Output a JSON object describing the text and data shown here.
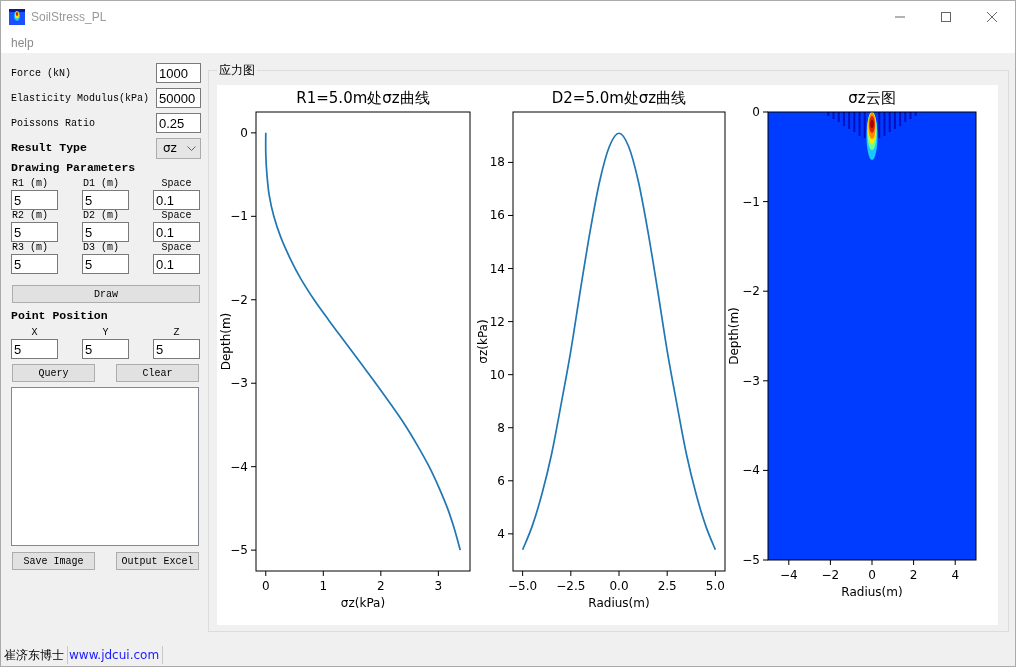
{
  "window": {
    "title": "SoilStress_PL"
  },
  "menu": [
    {
      "label": "help"
    }
  ],
  "inputs": [
    {
      "label": "Force (kN)",
      "value": "1000"
    },
    {
      "label": "Elasticity Modulus(kPa)",
      "value": "50000"
    },
    {
      "label": "Poissons Ratio",
      "value": "0.25"
    }
  ],
  "result_type": {
    "label": "Result Type",
    "value": "σz"
  },
  "drawing_parameters": {
    "title": "Drawing Parameters",
    "rows": [
      [
        {
          "label": "R1 (m)",
          "value": "5"
        },
        {
          "label": "D1 (m)",
          "value": "5"
        },
        {
          "label": "Space",
          "value": "0.1"
        }
      ],
      [
        {
          "label": "R2 (m)",
          "value": "5"
        },
        {
          "label": "D2 (m)",
          "value": "5"
        },
        {
          "label": "Space",
          "value": "0.1"
        }
      ],
      [
        {
          "label": "R3 (m)",
          "value": "5"
        },
        {
          "label": "D3 (m)",
          "value": "5"
        },
        {
          "label": "Space",
          "value": "0.1"
        }
      ]
    ]
  },
  "draw_button": {
    "label": "Draw"
  },
  "point_position": {
    "title": "Point Position",
    "fields": [
      {
        "label": "X",
        "value": "5"
      },
      {
        "label": "Y",
        "value": "5"
      },
      {
        "label": "Z",
        "value": "5"
      }
    ]
  },
  "query_buttons": [
    {
      "label": "Query"
    },
    {
      "label": "Clear"
    }
  ],
  "export_buttons": [
    {
      "label": "Save Image"
    },
    {
      "label": "Output Excel"
    }
  ],
  "stress_panel": {
    "title": "应力图",
    "plots": [
      {
        "kind": "line",
        "chart_data": {
          "type": "line",
          "title": "R1=5.0m处σz曲线",
          "xlabel": "σz(kPa)",
          "ylabel": "Depth(m)",
          "x": [
            0,
            0,
            0.02,
            0.06,
            0.14,
            0.26,
            0.42,
            0.61,
            0.84,
            1.1,
            1.37,
            1.64,
            1.91,
            2.17,
            2.42,
            2.64,
            2.84,
            3.01,
            3.16,
            3.28,
            3.38
          ],
          "series": [
            {
              "color": "#1f77b4",
              "values": [
                0,
                -0.25,
                -0.5,
                -0.75,
                -1,
                -1.25,
                -1.5,
                -1.75,
                -2,
                -2.25,
                -2.5,
                -2.75,
                -3,
                -3.25,
                -3.5,
                -3.75,
                -4,
                -4.25,
                -4.5,
                -4.75,
                -5
              ]
            }
          ],
          "xlim": [
            -0.17,
            3.55
          ],
          "ylim": [
            -5.25,
            0.25
          ],
          "xticks": [
            0,
            1,
            2,
            3
          ],
          "yticks": [
            0,
            {
              "value": -1,
              "label": "−1"
            },
            {
              "value": -2,
              "label": "−2"
            },
            {
              "value": -3,
              "label": "−3"
            },
            {
              "value": -4,
              "label": "−4"
            },
            {
              "value": -5,
              "label": "−5"
            }
          ]
        }
      },
      {
        "kind": "line",
        "chart_data": {
          "type": "line",
          "title": "D2=5.0m处σz曲线",
          "xlabel": "Radius(m)",
          "ylabel": "σz(kPa)",
          "x": [
            -5,
            -4.5,
            -4,
            -3.5,
            -3,
            -2.5,
            -2,
            -1.5,
            -1,
            -0.5,
            0,
            0.5,
            1,
            1.5,
            2,
            2.5,
            3,
            3.5,
            4,
            4.5,
            5
          ],
          "series": [
            {
              "color": "#1f77b4",
              "values": [
                3.4,
                4.3,
                5.5,
                7,
                8.9,
                10.9,
                13.2,
                15.4,
                17.3,
                18.6,
                19.1,
                18.6,
                17.3,
                15.4,
                13.2,
                10.9,
                8.9,
                7,
                5.5,
                4.3,
                3.4
              ]
            }
          ],
          "xlim": [
            -5.5,
            5.5
          ],
          "ylim": [
            2.6,
            19.9
          ],
          "xticks": [
            {
              "value": -5,
              "label": "−5.0"
            },
            {
              "value": -2.5,
              "label": "−2.5"
            },
            {
              "value": 0,
              "label": "0.0"
            },
            {
              "value": 2.5,
              "label": "2.5"
            },
            {
              "value": 5,
              "label": "5.0"
            }
          ],
          "yticks": [
            4,
            6,
            8,
            10,
            12,
            14,
            16,
            18
          ]
        }
      },
      {
        "kind": "contour",
        "title": "σz云图",
        "xlabel": "Radius(m)",
        "ylabel": "Depth(m)",
        "xticks": [
          "−4",
          "−2",
          "0",
          "2",
          "4"
        ],
        "yticks": [
          "0",
          "−1",
          "−2",
          "−3",
          "−4",
          "−5"
        ]
      }
    ]
  },
  "status_bar": [
    {
      "kind": "text",
      "text": "崔济东博士"
    },
    {
      "kind": "link",
      "text": "www.jdcui.com"
    }
  ]
}
